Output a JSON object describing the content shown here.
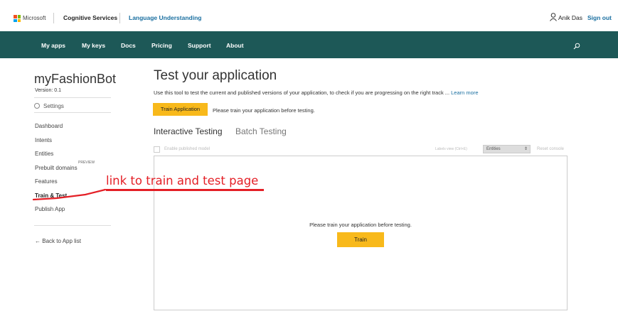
{
  "header": {
    "brand": "Microsoft",
    "product": "Cognitive Services",
    "service": "Language Understanding",
    "user_name": "Anik Das",
    "sign_out": "Sign out"
  },
  "nav": {
    "items": [
      {
        "label": "My apps"
      },
      {
        "label": "My keys"
      },
      {
        "label": "Docs"
      },
      {
        "label": "Pricing"
      },
      {
        "label": "Support"
      },
      {
        "label": "About"
      }
    ]
  },
  "sidebar": {
    "app_name": "myFashionBot",
    "version": "Version: 0.1",
    "settings": "Settings",
    "items": [
      {
        "label": "Dashboard"
      },
      {
        "label": "Intents"
      },
      {
        "label": "Entities"
      },
      {
        "label": "Prebuilt domains"
      },
      {
        "label": "Features"
      },
      {
        "label": "Train & Test"
      },
      {
        "label": "Publish App"
      }
    ],
    "preview_badge": "PREVIEW",
    "back": "Back to App list"
  },
  "main": {
    "title": "Test your application",
    "description": "Use this tool to test the current and published versions of your application, to check if you are progressing on the right track ... ",
    "learn_more": "Learn more",
    "train_app_label": "Train Application",
    "train_message": "Please train your application before testing.",
    "tabs": [
      {
        "label": "Interactive Testing",
        "active": true
      },
      {
        "label": "Batch Testing",
        "active": false
      }
    ],
    "enable_published": "Enable published model",
    "labels_view": "Labels view (Ctrl+E)",
    "entities_select": "Entities",
    "reset_console": "Reset console",
    "panel_message": "Please train your application before testing.",
    "train_label": "Train"
  },
  "annotation": {
    "text": "link to train and test page",
    "color": "#e41f26"
  },
  "colors": {
    "nav_bg": "#1d5857",
    "accent_yellow": "#f8b91b",
    "link_blue": "#1a6fa0"
  }
}
